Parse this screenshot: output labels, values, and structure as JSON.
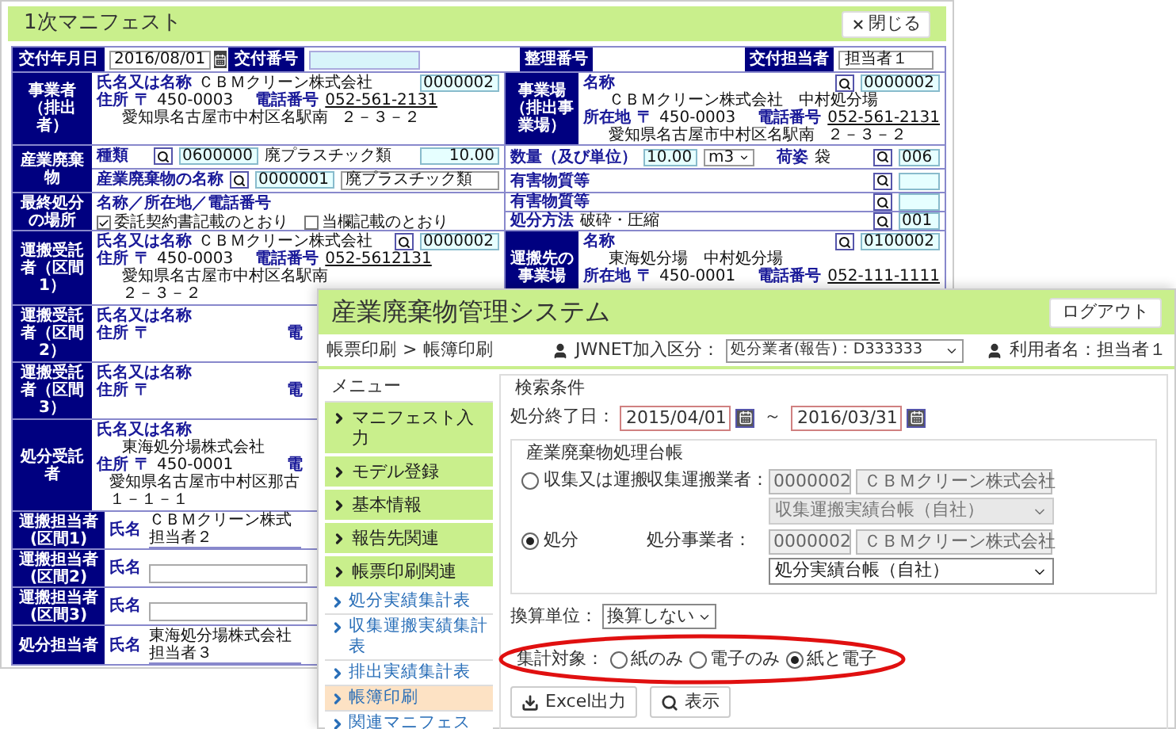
{
  "manifest": {
    "title": "1次マニフェスト",
    "close_button": "閉じる",
    "issue_date": {
      "label": "交付年月日",
      "value": "2016/08/01"
    },
    "issue_number": {
      "label": "交付番号"
    },
    "reference_number": {
      "label": "整理番号"
    },
    "issuer": {
      "label": "交付担当者",
      "value": "担当者１"
    },
    "generator": {
      "label": "事業者（排出者）",
      "name_label": "氏名又は名称",
      "lookup": false,
      "code": "0000002",
      "name_lines": [
        "ＣＢＭクリーン株式会社"
      ],
      "address_label": "住所",
      "postal_mark": "〒",
      "postal_code": "450-0003",
      "phone_label": "電話番号",
      "phone": "052-561-2131",
      "address_lines": [
        "愛知県名古屋市中村区名駅南",
        "２－３－２"
      ]
    },
    "site": {
      "label": "事業場（排出事業場）",
      "name_label": "名称",
      "lookup": true,
      "code": "0000002",
      "name_lines": [
        "ＣＢＭクリーン株式会社",
        "中村処分場"
      ],
      "address_label": "所在地",
      "postal_mark": "〒",
      "postal_code": "450-0003",
      "phone_label": "電話番号",
      "phone": "052-561-2131",
      "address_lines": [
        "愛知県名古屋市中村区名駅南",
        "２－３－２"
      ]
    },
    "waste": {
      "label": "産業廃棄物",
      "type_label": "種類",
      "type_code": "0600000",
      "type_name": "廃プラスチック類",
      "amount": "10.00",
      "name_label": "産業廃棄物の名称",
      "name_code": "0000001",
      "name": "廃プラスチック類"
    },
    "quantity": {
      "label": "数量（及び単位）",
      "value": "10.00",
      "unit": "m3"
    },
    "packaging": {
      "label": "荷姿",
      "value": "袋",
      "code": "006"
    },
    "hazardous": [
      {
        "label": "有害物質等"
      },
      {
        "label": "有害物質等"
      }
    ],
    "treatment": {
      "label": "処分方法",
      "value": "破砕・圧縮",
      "code": "001"
    },
    "final_disposal": {
      "label": "最終処分の場所",
      "field_label": "名称／所在地／電話番号",
      "options": [
        {
          "label": "委託契約書記載のとおり",
          "checked": true
        },
        {
          "label": "当欄記載のとおり",
          "checked": false
        }
      ]
    },
    "carrier_1": {
      "label": "運搬受託者（区間1）",
      "name_label": "氏名又は名称",
      "lookup": true,
      "code": "0000002",
      "name_lines": [
        "ＣＢＭクリーン株式会社"
      ],
      "address_label": "住所",
      "postal_mark": "〒",
      "postal_code": "450-0003",
      "phone_label": "電話番号",
      "phone": "052-5612131",
      "address_lines": [
        "愛知県名古屋市中村区名駅南",
        "２－３－２"
      ]
    },
    "destination": {
      "label": "運搬先の事業場",
      "name_label": "名称",
      "lookup": true,
      "code": "0100002",
      "name_lines": [
        "東海処分場",
        "中村処分場"
      ],
      "address_label": "所在地",
      "postal_mark": "〒",
      "postal_code": "450-0001",
      "phone_label": "電話番号",
      "phone": "052-111-1111"
    },
    "carrier_2": {
      "label": "運搬受託者（区間2）",
      "name_label": "氏名又は名称",
      "address_label": "住所",
      "postal_mark": "〒",
      "phone_label": "電"
    },
    "carrier_3": {
      "label": "運搬受託者（区間3）",
      "name_label": "氏名又は名称",
      "address_label": "住所",
      "postal_mark": "〒",
      "phone_label": "電"
    },
    "disposer": {
      "label": "処分受託者",
      "name_label": "氏名又は名称",
      "name_lines": [
        "東海処分場株式会社"
      ],
      "address_label": "住所",
      "postal_mark": "〒",
      "postal_code": "450-0001",
      "phone_label": "電",
      "address_lines": [
        "愛知県名古屋市中村区那古",
        "１－１－１"
      ]
    },
    "staff": [
      {
        "label": "運搬担当者(区間1)",
        "name_label": "氏名",
        "company": "ＣＢＭクリーン株式",
        "person": "担当者２"
      },
      {
        "label": "運搬担当者(区間2)",
        "name_label": "氏名"
      },
      {
        "label": "運搬担当者(区間3)",
        "name_label": "氏名"
      },
      {
        "label": "処分担当者",
        "name_label": "氏名",
        "company": "東海処分場株式会社",
        "person": "担当者３"
      }
    ]
  },
  "system": {
    "title": "産業廃棄物管理システム",
    "logout_button": "ログアウト",
    "breadcrumb": [
      "帳票印刷",
      "帳簿印刷"
    ],
    "breadcrumb_separator": ">",
    "jwnet_label": "JWNET加入区分：",
    "jwnet_value": "処分業者(報告)：D333333",
    "user_label": "利用者名：担当者１",
    "menu_title": "メニュー",
    "menu": [
      {
        "label": "マニフェスト入力",
        "kind": "group",
        "selected": false
      },
      {
        "label": "モデル登録",
        "kind": "group",
        "selected": false
      },
      {
        "label": "基本情報",
        "kind": "group",
        "selected": false
      },
      {
        "label": "報告先関連",
        "kind": "group",
        "selected": false
      },
      {
        "label": "帳票印刷関連",
        "kind": "group",
        "selected": false
      },
      {
        "label": "処分実績集計表",
        "kind": "link",
        "selected": false
      },
      {
        "label": "収集運搬実績集計表",
        "kind": "link",
        "selected": false
      },
      {
        "label": "排出実績集計表",
        "kind": "link",
        "selected": false
      },
      {
        "label": "帳簿印刷",
        "kind": "link",
        "selected": true
      },
      {
        "label": "関連マニフェス",
        "kind": "link",
        "selected": false
      }
    ],
    "search": {
      "legend": "検索条件",
      "end_date_label": "処分終了日：",
      "date_from": "2015/04/01",
      "range_separator": "～",
      "date_to": "2016/03/31",
      "ledger": {
        "legend": "産業廃棄物処理台帳",
        "options": [
          {
            "label": "収集又は運搬",
            "selected": false,
            "company_label": "収集運搬業者：",
            "company_code": "0000002",
            "company_name": "ＣＢＭクリーン株式会社",
            "ledger_type": "収集運搬実績台帳（自社）"
          },
          {
            "label": "処分",
            "selected": true,
            "company_label": "処分事業者：",
            "company_code": "0000002",
            "company_name": "ＣＢＭクリーン株式会社",
            "ledger_type": "処分実績台帳（自社）"
          }
        ]
      },
      "unit_label": "換算単位：",
      "unit_value": "換算しない",
      "target_label": "集計対象：",
      "targets": [
        {
          "label": "紙のみ",
          "selected": false
        },
        {
          "label": "電子のみ",
          "selected": false
        },
        {
          "label": "紙と電子",
          "selected": true
        }
      ],
      "buttons": [
        {
          "label": "Excel出力",
          "kind": "export"
        },
        {
          "label": "表示",
          "kind": "search"
        }
      ]
    }
  }
}
